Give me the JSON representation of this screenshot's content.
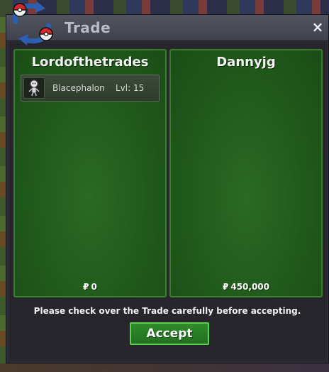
{
  "window": {
    "title": "Trade",
    "close_symbol": "×"
  },
  "left_panel": {
    "trader_name": "Lordofthetrades",
    "currency_symbol": "₽",
    "money": "0",
    "items": [
      {
        "name": "Blacephalon",
        "level": "Lvl: 15",
        "icon": "blacephalon-sprite-icon"
      }
    ]
  },
  "right_panel": {
    "trader_name": "Dannyjg",
    "currency_symbol": "₽",
    "money": "450,000",
    "items": []
  },
  "notice": "Please check over the Trade carefully before accepting.",
  "accept_label": "Accept",
  "colors": {
    "panel_green": "#205a1b",
    "panel_border": "#3a7d2f",
    "accept_border": "#5ad04c",
    "titlebar": "#4a4c56"
  }
}
